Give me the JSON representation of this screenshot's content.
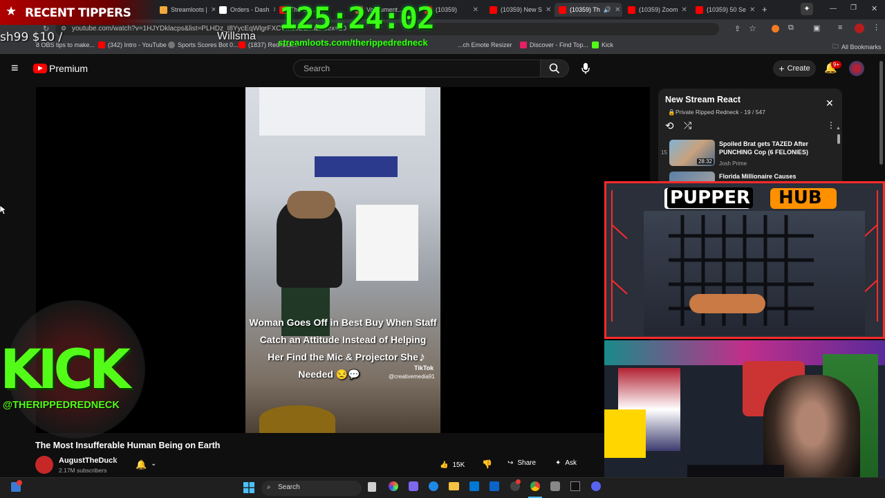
{
  "tabs": [
    {
      "label": "Streamloots |",
      "fav": "#f2a93b"
    },
    {
      "label": "Orders - Dash",
      "fav": "#ffffff"
    },
    {
      "label": "The ad...",
      "fav": "#ff0000"
    },
    {
      "label": "Vodcument...",
      "fav": "#e53935"
    },
    {
      "label": "(10359)",
      "fav": "#ff0000"
    },
    {
      "label": "(10359) New S",
      "fav": "#ff0000"
    },
    {
      "label": "(10359) Th",
      "fav": "#ff0000"
    },
    {
      "label": "(10359) Zoom",
      "fav": "#ff0000"
    },
    {
      "label": "(10359) 50 Se",
      "fav": "#ff0000"
    }
  ],
  "address": {
    "url": "youtube.com/watch?v=1HJYDklacps&list=PLHDz_I8YycEqWlgrFXCVmceBE...&index=20"
  },
  "bookmarks": {
    "items": [
      "8 OBS tips to make...",
      "(342) Intro - YouTube",
      "Sports Scores Bot 0...",
      "(1837) Redneck...",
      "...ch Emote Resizer",
      "Discover - Find Top...",
      "Kick"
    ],
    "all_label": "All Bookmarks"
  },
  "yt": {
    "brand": "Premium",
    "search_placeholder": "Search",
    "create_label": "Create",
    "notif_count": "9+"
  },
  "video": {
    "caption_lines": [
      "Woman Goes Off in Best Buy When Staff",
      "Catch an Attitude Instead of Helping",
      "Her Find the Mic & Projector She",
      "Needed 😒💬"
    ],
    "tiktok": "TikTok",
    "handle": "@creativemedia91",
    "title": "The Most Insufferable Human Being on Earth",
    "channel": "AugustTheDuck",
    "subscribers": "2.17M subscribers",
    "likes": "15K",
    "share": "Share",
    "ask": "Ask"
  },
  "playlist": {
    "title": "New Stream React",
    "meta": "Private Ripped Redneck - 19 / 547",
    "items": [
      {
        "index": "15",
        "title": "Spoiled Brat gets TAZED After PUNCHING Cop (6 FELONIES)",
        "channel": "Josh Prime",
        "duration": "28:32"
      },
      {
        "index": "",
        "title": "Florida Millionaire Causes",
        "channel": "",
        "duration": ""
      }
    ]
  },
  "overlay": {
    "tippers": "RECENT TIPPERS",
    "timer": "125:24:02",
    "streamloots_url": "streamloots.com/therippedredneck",
    "tipper_line": "sh99 $10 /",
    "tipper_name": "Willsma",
    "kick_word": "KICK",
    "kick_handle": "@THERIPPEDREDNECK",
    "pupper_word": "PUPPER",
    "hub_word": "HUB"
  },
  "taskbar": {
    "search": "Search"
  },
  "colors": {
    "yt_red": "#ff0000",
    "timer_green": "#39ff14",
    "kick_green": "#53fc18",
    "overlay_red": "#ff2a2a",
    "hub_orange": "#ff9000"
  }
}
